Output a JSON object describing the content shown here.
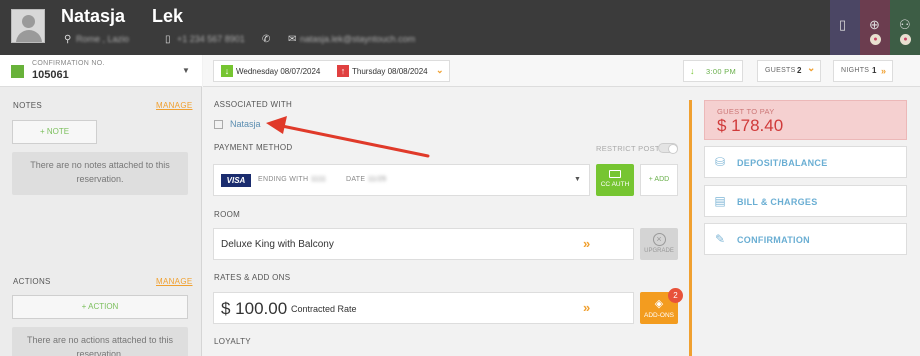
{
  "header": {
    "first_name": "Natasja",
    "last_name": "Lek",
    "location": "Rome , Lazio",
    "phone": "+1 234 567 8901",
    "email": "natasja.lek@stayntouch.com"
  },
  "reservation": {
    "conf_label": "CONFIRMATION NO.",
    "conf_number": "105061"
  },
  "notes": {
    "title": "NOTES",
    "manage": "MANAGE",
    "add": "+ NOTE",
    "empty": "There are no notes attached to this reservation."
  },
  "actions": {
    "title": "ACTIONS",
    "manage": "MANAGE",
    "add": "+ ACTION",
    "empty": "There are no actions attached to this reservation."
  },
  "stay": {
    "arrival": "Wednesday 08/07/2024",
    "departure": "Thursday 08/08/2024",
    "time": "3:00 PM",
    "guests_label": "GUESTS",
    "guests": "2",
    "nights_label": "NIGHTS",
    "nights": "1"
  },
  "associated": {
    "title": "ASSOCIATED WITH",
    "name": "Natasja"
  },
  "payment": {
    "title": "PAYMENT METHOD",
    "restrict": "RESTRICT POST",
    "card_brand": "VISA",
    "ending_label": "ENDING WITH",
    "ending": "1111",
    "date_label": "DATE",
    "date": "11/25",
    "cc_auth": "CC AUTH",
    "add": "+ ADD"
  },
  "room": {
    "title": "ROOM",
    "type": "Deluxe King with Balcony",
    "upgrade": "UPGRADE"
  },
  "rates": {
    "title": "RATES & ADD ONS",
    "amount": "$ 100.00",
    "rate_name": "Contracted Rate",
    "addons": "ADD-ONS",
    "addons_count": "2"
  },
  "loyalty": {
    "title": "LOYALTY"
  },
  "billing": {
    "guest_to_pay_label": "GUEST TO PAY",
    "guest_to_pay": "$ 178.40",
    "deposit": "DEPOSIT/BALANCE",
    "bill": "BILL & CHARGES",
    "confirmation": "CONFIRMATION"
  },
  "colors": {
    "accent": "#f0a030",
    "link": "#6aaed3",
    "success": "#76c531",
    "danger": "#d03a3a",
    "annotation": "#e03a2a"
  }
}
